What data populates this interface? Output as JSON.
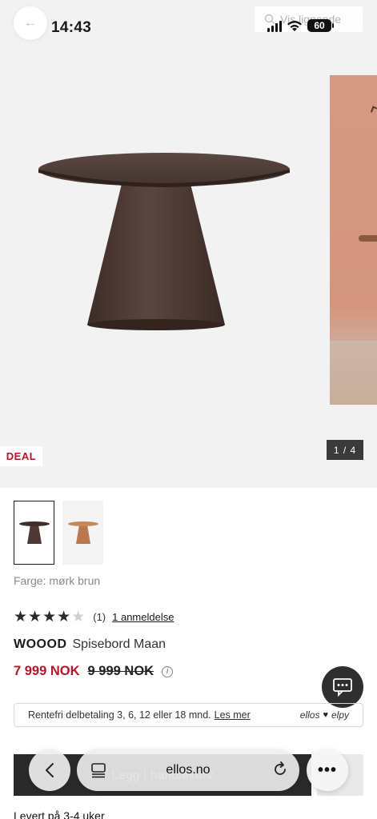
{
  "status_bar": {
    "time": "14:43",
    "battery": "60"
  },
  "header": {
    "similar_label": "Vis lignende"
  },
  "gallery": {
    "deal_label": "DEAL",
    "counter": "1 / 4"
  },
  "product": {
    "color_label": "Farge: mørk brun",
    "rating": {
      "stars_filled": 4,
      "stars_total": 5,
      "count": "(1)",
      "reviews_link": "1 anmeldelse"
    },
    "brand": "WOOOD",
    "name": "Spisebord Maan",
    "price": "7 999 NOK",
    "old_price": "9 999 NOK",
    "info_icon": "i"
  },
  "financing": {
    "text": "Rentefri delbetaling 3, 6, 12 eller 18 mnd.",
    "link": "Les mer",
    "logo_left": "ellos",
    "logo_right": "elpy"
  },
  "cart": {
    "label": "Legg i handlekurv"
  },
  "browser": {
    "url": "ellos.no",
    "more": "•••"
  },
  "delivery": "Levert på 3-4 uker",
  "colors": {
    "accent_red": "#b3162b",
    "dark": "#2a2a2a",
    "table_brown": "#4e3a33"
  },
  "icons": [
    "back-arrow-icon",
    "search-image-icon",
    "signal-icon",
    "wifi-icon",
    "battery-icon",
    "chat-icon",
    "info-icon",
    "tabs-icon",
    "reload-icon",
    "chevron-left-icon",
    "more-icon",
    "heart-icon",
    "star-icon"
  ]
}
